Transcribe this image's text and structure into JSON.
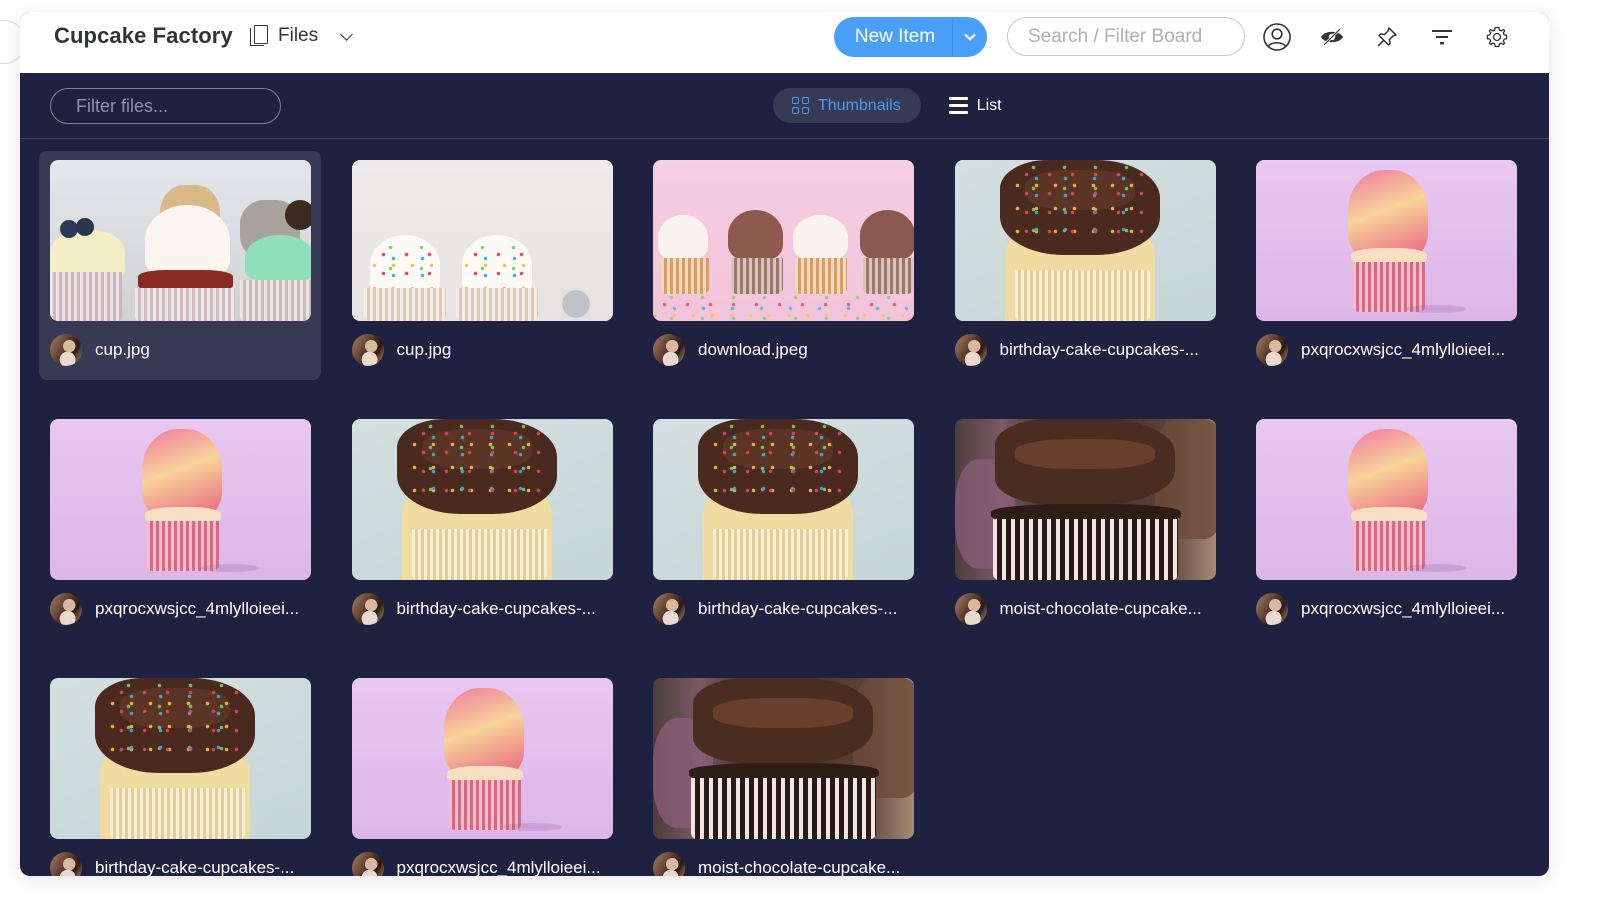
{
  "header": {
    "board_title": "Cupcake Factory",
    "view_label": "Files",
    "new_item_label": "New Item",
    "search_placeholder": "Search / Filter Board",
    "icons": [
      "person-icon",
      "eye-off-icon",
      "pin-icon",
      "filter-icon",
      "gear-icon"
    ]
  },
  "toolbar": {
    "filter_placeholder": "Filter files...",
    "views": [
      {
        "label": "Thumbnails",
        "icon": "grid-icon",
        "active": true
      },
      {
        "label": "List",
        "icon": "list-icon",
        "active": false
      }
    ]
  },
  "colors": {
    "accent": "#4aa0f8",
    "board_bg": "#1e2140",
    "selected_card_bg": "#373a55",
    "active_view_text": "#4a9cf0"
  },
  "files": [
    {
      "name": "cup.jpg",
      "thumb": "assorted-cupcakes",
      "selected": true
    },
    {
      "name": "cup.jpg",
      "thumb": "sprinkle-cupcakes",
      "selected": false
    },
    {
      "name": "download.jpeg",
      "thumb": "four-cupcakes-pink",
      "selected": false
    },
    {
      "name": "birthday-cake-cupcakes-...",
      "thumb": "chocolate-frosting-cupcake",
      "selected": false
    },
    {
      "name": "pxqrocxwsjcc_4mlylloieei...",
      "thumb": "pink-swirl-cupcake",
      "selected": false
    },
    {
      "name": "pxqrocxwsjcc_4mlylloieei...",
      "thumb": "pink-swirl-cupcake",
      "selected": false
    },
    {
      "name": "birthday-cake-cupcakes-...",
      "thumb": "chocolate-frosting-cupcake",
      "selected": false
    },
    {
      "name": "birthday-cake-cupcakes-...",
      "thumb": "chocolate-frosting-cupcake",
      "selected": false
    },
    {
      "name": "moist-chocolate-cupcake...",
      "thumb": "dark-chocolate-cupcake",
      "selected": false
    },
    {
      "name": "pxqrocxwsjcc_4mlylloieei...",
      "thumb": "pink-swirl-cupcake",
      "selected": false
    },
    {
      "name": "birthday-cake-cupcakes-...",
      "thumb": "chocolate-frosting-cupcake",
      "selected": false
    },
    {
      "name": "pxqrocxwsjcc_4mlylloieei...",
      "thumb": "pink-swirl-cupcake",
      "selected": false
    },
    {
      "name": "moist-chocolate-cupcake...",
      "thumb": "dark-chocolate-cupcake",
      "selected": false
    }
  ]
}
